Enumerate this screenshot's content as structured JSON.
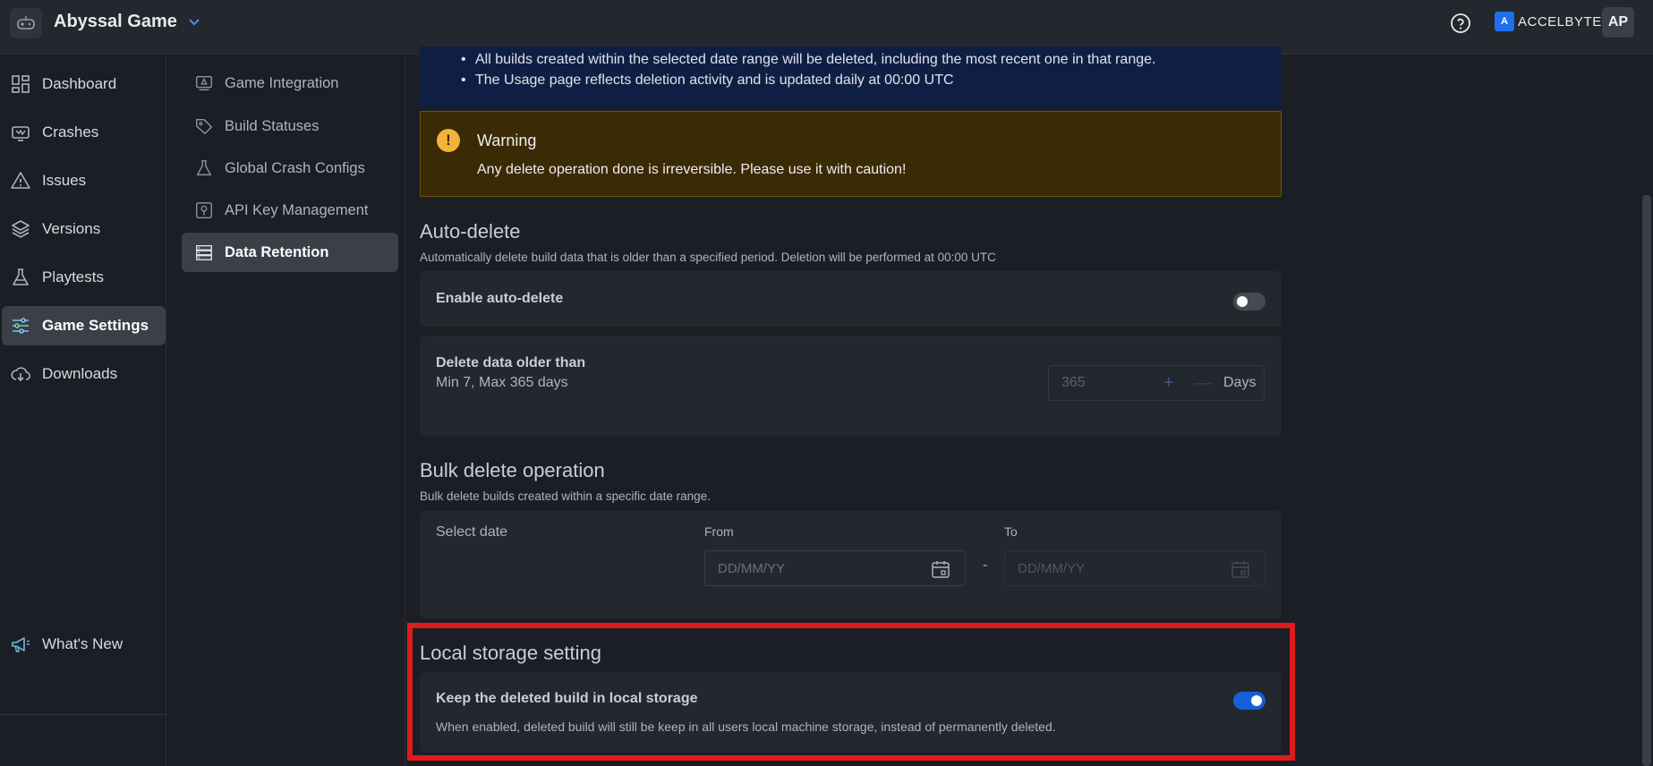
{
  "header": {
    "game_name": "Abyssal Game",
    "brand_text": "ACCELBYTE",
    "avatar_initials": "AP"
  },
  "leftnav": {
    "items": [
      {
        "label": "Dashboard",
        "icon": "dashboard-icon"
      },
      {
        "label": "Crashes",
        "icon": "crash-icon"
      },
      {
        "label": "Issues",
        "icon": "warning-icon"
      },
      {
        "label": "Versions",
        "icon": "layers-icon"
      },
      {
        "label": "Playtests",
        "icon": "flask-icon"
      },
      {
        "label": "Game Settings",
        "icon": "sliders-icon",
        "active": true
      },
      {
        "label": "Downloads",
        "icon": "cloud-download-icon"
      }
    ],
    "whats_new": "What's New",
    "collapse_glyph": "«"
  },
  "subnav": {
    "items": [
      {
        "label": "Game Integration",
        "icon": "integration-icon"
      },
      {
        "label": "Build Statuses",
        "icon": "tag-icon"
      },
      {
        "label": "Global Crash Configs",
        "icon": "flask-icon"
      },
      {
        "label": "API Key Management",
        "icon": "key-icon"
      },
      {
        "label": "Data Retention",
        "icon": "server-icon",
        "active": true
      }
    ]
  },
  "info": {
    "bullets": [
      "All builds created within the selected date range will be deleted, including the most recent one in that range.",
      "The Usage page reflects deletion activity and is updated daily at 00:00 UTC"
    ]
  },
  "warning": {
    "icon_glyph": "!",
    "title": "Warning",
    "text": "Any delete operation done is irreversible. Please use it with caution!"
  },
  "auto_delete": {
    "title": "Auto-delete",
    "description": "Automatically delete build data that is older than a specified period. Deletion will be performed at 00:00 UTC",
    "enable_label": "Enable auto-delete",
    "enabled": false,
    "older_than_label": "Delete data older than",
    "range_hint": "Min 7, Max 365 days",
    "days_value": "365",
    "plus_glyph": "+",
    "minus_glyph": "—",
    "unit": "Days"
  },
  "bulk_delete": {
    "title": "Bulk delete operation",
    "description": "Bulk delete builds created within a specific date range.",
    "select_label": "Select date",
    "from_label": "From",
    "to_label": "To",
    "dash": "-",
    "from_placeholder": "DD/MM/YY",
    "to_placeholder": "DD/MM/YY"
  },
  "local_storage": {
    "title": "Local storage setting",
    "keep_label": "Keep the deleted build in local storage",
    "keep_description": "When enabled, deleted build will still be keep in all users local machine storage, instead of permanently deleted.",
    "enabled": true
  }
}
